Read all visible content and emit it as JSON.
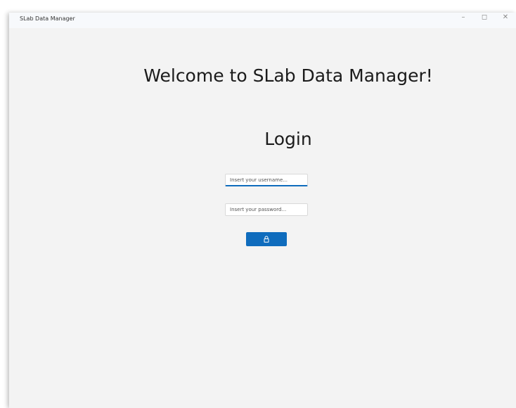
{
  "window": {
    "title": "SLab Data Manager",
    "controls": {
      "minimize_icon": "minimize-icon",
      "maximize_icon": "maximize-icon",
      "close_icon": "close-icon"
    }
  },
  "main": {
    "welcome_title": "Welcome to SLab Data Manager!",
    "login_title": "Login",
    "username": {
      "value": "",
      "placeholder": "Insert your username..."
    },
    "password": {
      "value": "",
      "placeholder": "Insert your password..."
    },
    "login_button": {
      "icon": "lock-icon"
    }
  },
  "colors": {
    "accent": "#0f6cbd",
    "background": "#f3f3f3",
    "title_text": "#1b1b1b"
  }
}
